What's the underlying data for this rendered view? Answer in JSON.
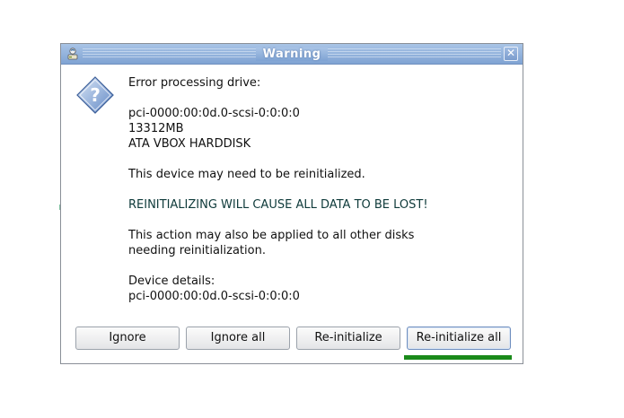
{
  "window": {
    "title": "Warning",
    "close_glyph": "✕",
    "app_icon": "installer-icon"
  },
  "dialog": {
    "icon": "question-icon",
    "message_lines": {
      "l1": "Error processing drive:",
      "l2": "pci-0000:00:0d.0-scsi-0:0:0:0",
      "l3": "13312MB",
      "l4": "ATA VBOX HARDDISK",
      "l5": "This device may need to be reinitialized.",
      "l6": "REINITIALIZING WILL CAUSE ALL DATA TO BE LOST!",
      "l7": "This action may also be applied to all other disks",
      "l8": "needing reinitialization.",
      "l9": "Device details:",
      "l10": "pci-0000:00:0d.0-scsi-0:0:0:0"
    }
  },
  "buttons": {
    "ignore": "Ignore",
    "ignore_all": "Ignore all",
    "reinitialize": "Re-initialize",
    "reinitialize_all": "Re-initialize all"
  },
  "colors": {
    "titlebar": "#7fa3d3",
    "focus_indicator": "#1a8a1a"
  }
}
